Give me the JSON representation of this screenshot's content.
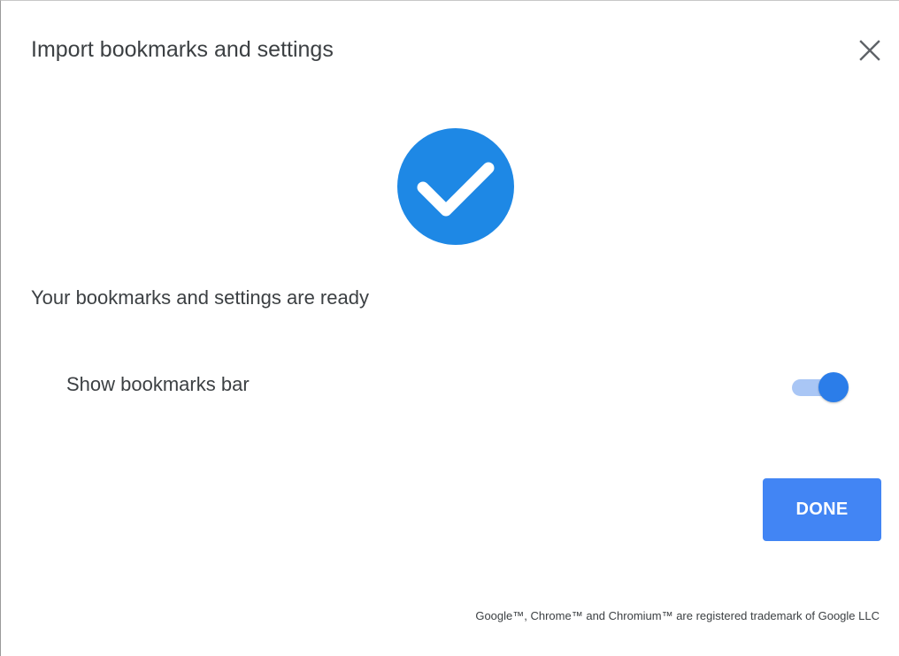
{
  "dialog": {
    "title": "Import bookmarks and settings",
    "close_icon": "close-icon",
    "status_icon": "check-circle-icon",
    "ready_message": "Your bookmarks and settings are ready",
    "toggle": {
      "label": "Show bookmarks bar",
      "checked": true
    },
    "done_label": "DONE",
    "trademark_notice": "Google™, Chrome™ and Chromium™ are registered trademark of Google LLC"
  },
  "colors": {
    "accent": "#1e88e5",
    "button": "#4285f4",
    "toggle_knob": "#2b7de9",
    "toggle_track": "#a9c6f5",
    "text": "#3c4043"
  }
}
